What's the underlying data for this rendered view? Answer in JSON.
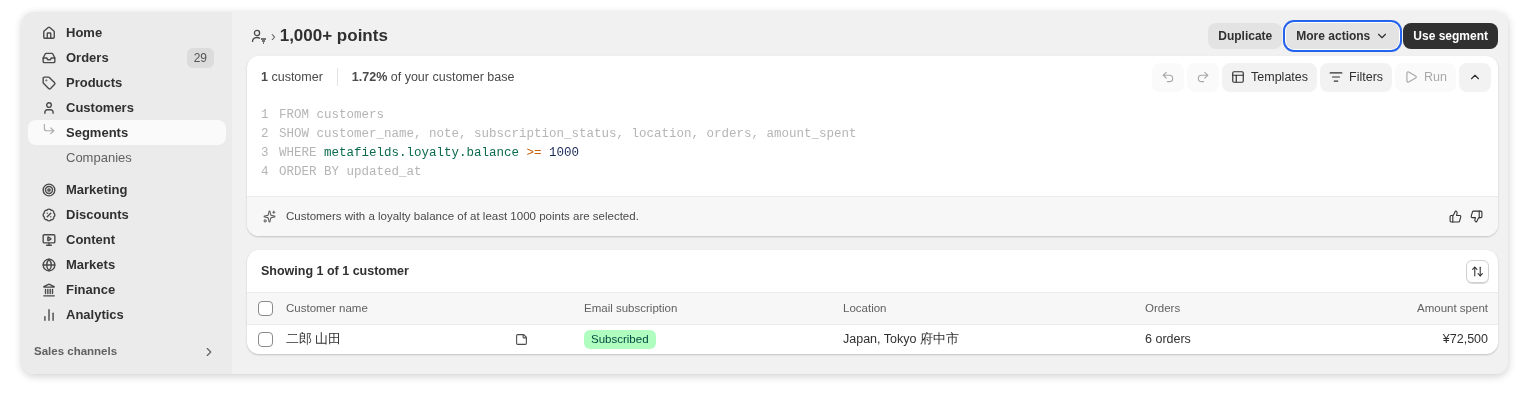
{
  "sidebar": {
    "sections": [
      {
        "items": [
          {
            "label": "Home",
            "selected": false
          },
          {
            "label": "Orders",
            "selected": false,
            "badge": "29"
          },
          {
            "label": "Products",
            "selected": false
          },
          {
            "label": "Customers",
            "selected": false,
            "children": [
              {
                "label": "Segments",
                "selected": true
              },
              {
                "label": "Companies",
                "selected": false
              }
            ]
          }
        ]
      },
      {
        "items": [
          {
            "label": "Marketing",
            "selected": false
          },
          {
            "label": "Discounts",
            "selected": false
          },
          {
            "label": "Content",
            "selected": false
          },
          {
            "label": "Markets",
            "selected": false
          },
          {
            "label": "Finance",
            "selected": false
          },
          {
            "label": "Analytics",
            "selected": false
          }
        ]
      }
    ],
    "sales_channels": {
      "label": "Sales channels"
    }
  },
  "header": {
    "breadcrumb_separator": "›",
    "title": "1,000+ points",
    "actions": [
      {
        "label": "Duplicate",
        "kind": "secondary",
        "focused": false
      },
      {
        "label": "More actions",
        "kind": "menu",
        "focused": true
      },
      {
        "label": "Use segment",
        "kind": "primary",
        "focused": false
      }
    ]
  },
  "editor": {
    "summary": [
      {
        "text": "**1** customer"
      },
      {
        "text": "**1.72%** of your customer base"
      }
    ],
    "toolbar": [
      {
        "kind": "undo",
        "disabled": true
      },
      {
        "kind": "redo",
        "disabled": true
      },
      {
        "kind": "templates",
        "label": "Templates",
        "disabled": false
      },
      {
        "kind": "filters",
        "label": "Filters",
        "disabled": false
      },
      {
        "kind": "run",
        "label": "Run",
        "disabled": true
      },
      {
        "kind": "collapse",
        "disabled": false
      }
    ],
    "lines": [
      {
        "number": "1",
        "tokens": [
          {
            "text": "FROM customers",
            "kind": "plain"
          }
        ]
      },
      {
        "number": "2",
        "tokens": [
          {
            "text": "SHOW customer_name, note, subscription_status, location, orders, amount_spent",
            "kind": "plain"
          }
        ]
      },
      {
        "number": "3",
        "tokens": [
          {
            "text": "WHERE ",
            "kind": "plain"
          },
          {
            "text": "metafields.loyalty.balance",
            "kind": "field"
          },
          {
            "text": " >=",
            "kind": "operator"
          },
          {
            "text": " 1000",
            "kind": "number"
          }
        ]
      },
      {
        "number": "4",
        "tokens": [
          {
            "text": "ORDER BY updated_at",
            "kind": "plain"
          }
        ]
      }
    ],
    "explanation": "Customers with a loyalty balance of at least 1000 points are selected."
  },
  "results": {
    "title": "Showing 1 of 1 customer",
    "select_all": false,
    "columns": [
      "Customer name",
      "Email subscription",
      "Location",
      "Orders",
      "Amount spent"
    ],
    "rows": [
      {
        "selected": false,
        "name": "二郎 山田",
        "has_note": true,
        "email_subscription": "Subscribed",
        "location": "Japan, Tokyo 府中市",
        "orders": "6 orders",
        "amount_spent": "¥72,500"
      }
    ]
  }
}
